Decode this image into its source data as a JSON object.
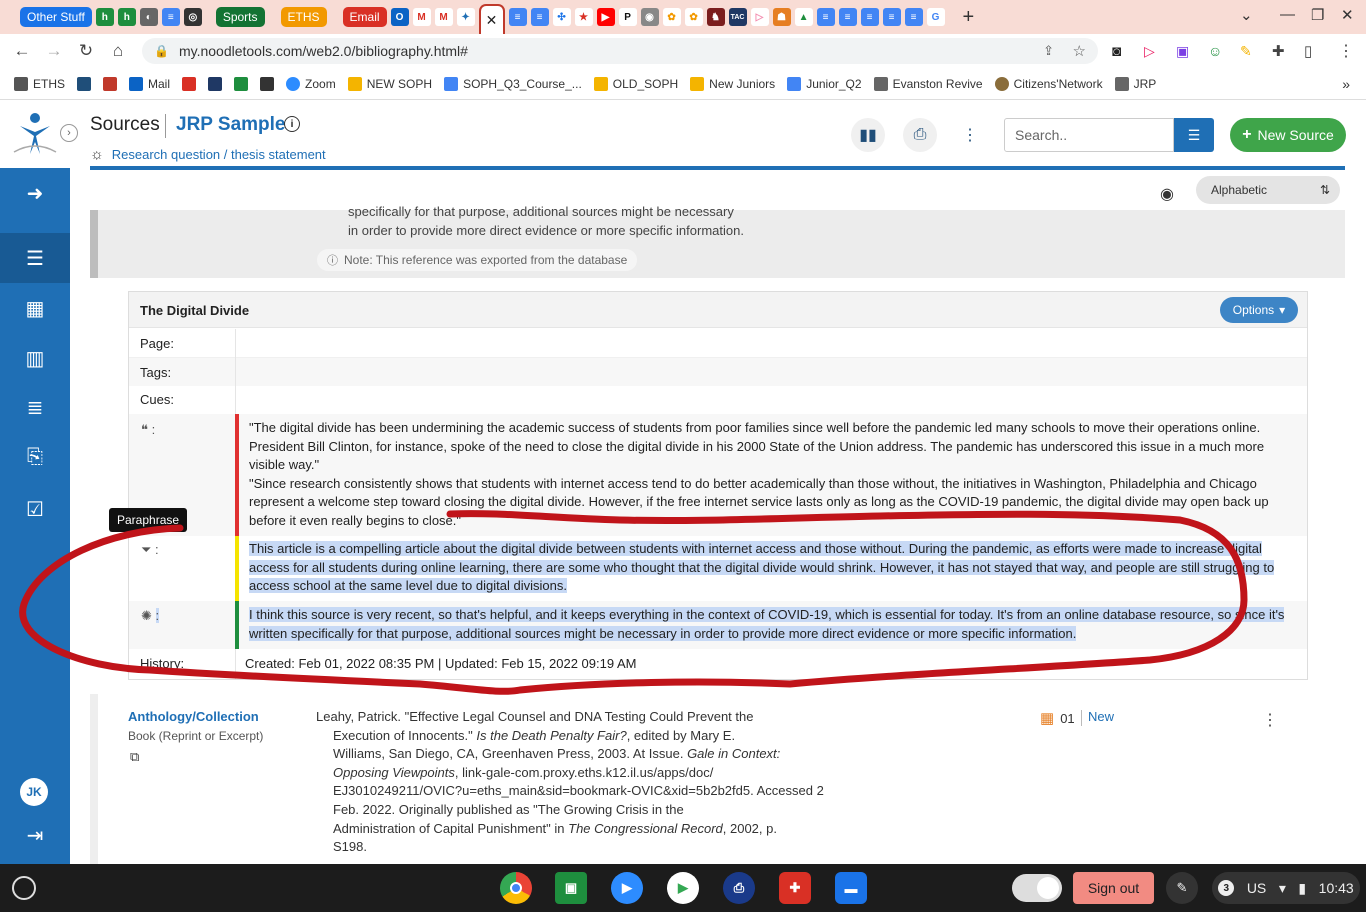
{
  "tabs": {
    "groups": [
      {
        "label": "Other Stuff",
        "color": "#1a73e8"
      },
      {
        "label": "Sports",
        "color": "#137333"
      },
      {
        "label": "ETHS",
        "color": "#f29900"
      },
      {
        "label": "Email",
        "color": "#d93025"
      }
    ],
    "new_tab": "+",
    "close_active": "✕"
  },
  "address": {
    "url": "my.noodletools.com/web2.0/bibliography.html#"
  },
  "bookmarks": [
    {
      "label": "ETHS",
      "color": "#555"
    },
    {
      "label": "",
      "color": "#1f4e79"
    },
    {
      "label": "",
      "color": "#c0392b"
    },
    {
      "label": "Mail",
      "color": "#0b63c5"
    },
    {
      "label": "",
      "color": "#d93025"
    },
    {
      "label": "",
      "color": "#1f3864"
    },
    {
      "label": "",
      "color": "#1e8e3e"
    },
    {
      "label": "",
      "color": "#333"
    },
    {
      "label": "Zoom",
      "color": "#2d8cff"
    },
    {
      "label": "NEW SOPH",
      "color": "#f4b400"
    },
    {
      "label": "SOPH_Q3_Course_...",
      "color": "#4285f4"
    },
    {
      "label": "OLD_SOPH",
      "color": "#f4b400"
    },
    {
      "label": "New Juniors",
      "color": "#f4b400"
    },
    {
      "label": "Junior_Q2",
      "color": "#4285f4"
    },
    {
      "label": "Evanston Revive",
      "color": "#666"
    },
    {
      "label": "Citizens'Network",
      "color": "#8a6d3b"
    },
    {
      "label": "JRP",
      "color": "#666"
    }
  ],
  "header": {
    "section": "Sources",
    "project": "JRP Sample",
    "research_link": "Research question / thesis statement",
    "search_placeholder": "Search..",
    "new_source": "New Source"
  },
  "sort": {
    "selected": "Alphabetic"
  },
  "previous_card": {
    "line1": "specifically for that purpose, additional sources might be necessary",
    "line2": "in order to provide more direct evidence or more specific information.",
    "note": "Note: This reference was exported from the database"
  },
  "card": {
    "title": "The Digital Divide",
    "options_label": "Options",
    "page_label": "Page:",
    "tags_label": "Tags:",
    "cues_label": "Cues:",
    "colon": ":",
    "quote": "\"The digital divide has been undermining the academic success of students from poor families since well before the pandemic led many schools to move their operations online. President Bill Clinton, for instance, spoke of the need to close the digital divide in his 2000 State of the Union address. The pandemic has underscored this issue in a much more visible way.\"\n\"Since research consistently shows that students with internet access tend to do better academically than those without, the initiatives in Washington, Philadelphia and Chicago represent a welcome step toward closing the digital divide. However, if the free internet service lasts only as long as the COVID-19 pandemic, the digital divide may open back up before it even really begins to close.\"",
    "paraphrase": "This article is a compelling article about the digital divide between students with internet access and those without.  During the pandemic, as efforts were made to increase digital access for all students during online learning, there are some who thought that the digital divide would shrink. However, it has not stayed that way, and people are still struggling to access school at the same level due to digital divisions.",
    "idea": "I think this source is very recent, so that's helpful, and it keeps everything in the context of COVID-19, which is essential for today. It's from an online database resource, so since it's written specifically for that purpose, additional sources might be necessary in order to provide more direct evidence or more specific information.",
    "history_label": "History:",
    "history": "Created: Feb 01, 2022 08:35 PM | Updated: Feb 15, 2022 09:19 AM",
    "tooltip": "Paraphrase"
  },
  "next_source": {
    "type": "Anthology/Collection",
    "subtype": "Book (Reprint or Excerpt)",
    "cite": {
      "l1": "Leahy, Patrick. \"Effective Legal Counsel and DNA Testing Could Prevent the",
      "l2a": "Execution of Innocents.\" ",
      "l2i": "Is the Death Penalty Fair?",
      "l2b": ", edited by Mary E.",
      "l3a": "Williams, San Diego, CA, Greenhaven Press, 2003. At Issue. ",
      "l3i": "Gale in Context:",
      "l4i": "Opposing Viewpoints",
      "l4b": ", link-gale-com.proxy.eths.k12.il.us/apps/doc/",
      "l5": "EJ3010249211/OVIC?u=eths_main&sid=bookmark-OVIC&xid=5b2b2fd5. Accessed 2",
      "l6": "Feb. 2022. Originally published as \"The Growing Crisis in the",
      "l7a": "Administration of Capital Punishment\" in ",
      "l7i": "The Congressional Record",
      "l7b": ", 2002, p.",
      "l8": "S198."
    },
    "count": "01",
    "status": "New"
  },
  "sidebar": {
    "avatar": "JK"
  },
  "shelf": {
    "sign_out": "Sign out",
    "notif_count": "3",
    "locale": "US",
    "time": "10:43"
  }
}
